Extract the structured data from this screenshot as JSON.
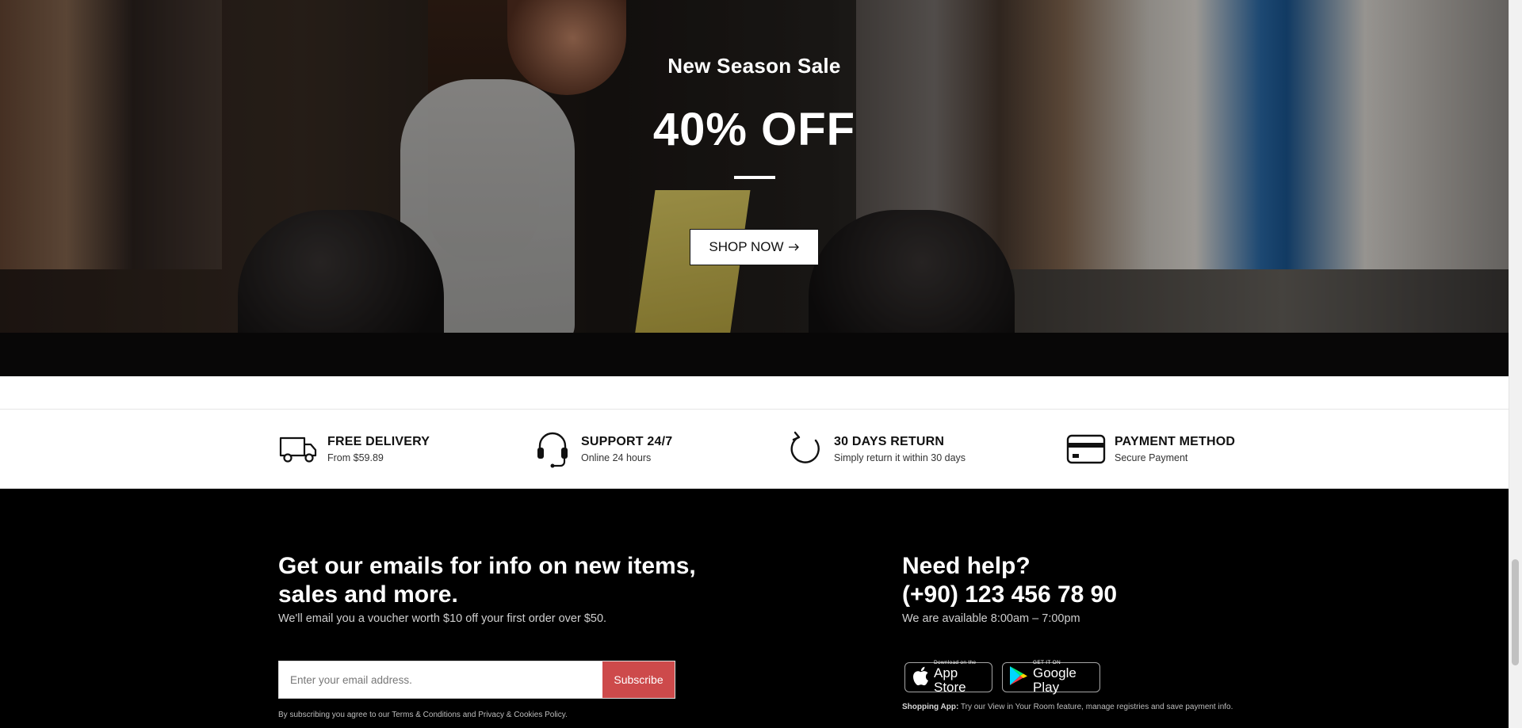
{
  "hero": {
    "subtitle": "New Season Sale",
    "title": "40% OFF",
    "cta_label": "SHOP NOW",
    "cta_icon": "arrow-right-icon"
  },
  "features": [
    {
      "icon": "truck-icon",
      "title": "FREE DELIVERY",
      "desc": "From $59.89"
    },
    {
      "icon": "headset-icon",
      "title": "SUPPORT 24/7",
      "desc": "Online 24 hours"
    },
    {
      "icon": "refresh-icon",
      "title": "30 DAYS RETURN",
      "desc": "Simply return it within 30 days"
    },
    {
      "icon": "credit-card-icon",
      "title": "PAYMENT METHOD",
      "desc": "Secure Payment"
    }
  ],
  "newsletter": {
    "title": "Get our emails for info on new items, sales and more.",
    "desc": "We'll email you a voucher worth $10 off your first order over $50.",
    "placeholder": "Enter your email address.",
    "button": "Subscribe",
    "legal_prefix": "By subscribing you agree to our ",
    "legal_terms": "Terms & Conditions",
    "legal_and": " and ",
    "legal_privacy": "Privacy & Cookies Policy",
    "legal_suffix": "."
  },
  "help": {
    "title": "Need help?",
    "phone": "(+90) 123 456 78 90",
    "hours": "We are available 8:00am – 7:00pm",
    "app_store_small": "Download on the",
    "app_store_big": "App Store",
    "google_play_small": "GET IT ON",
    "google_play_big": "Google Play",
    "app_note_label": "Shopping App:",
    "app_note_text": " Try our View in Your Room feature, manage registries and save payment info."
  },
  "colors": {
    "subscribe": "#cd4a4b",
    "footer_bg": "#000000"
  }
}
